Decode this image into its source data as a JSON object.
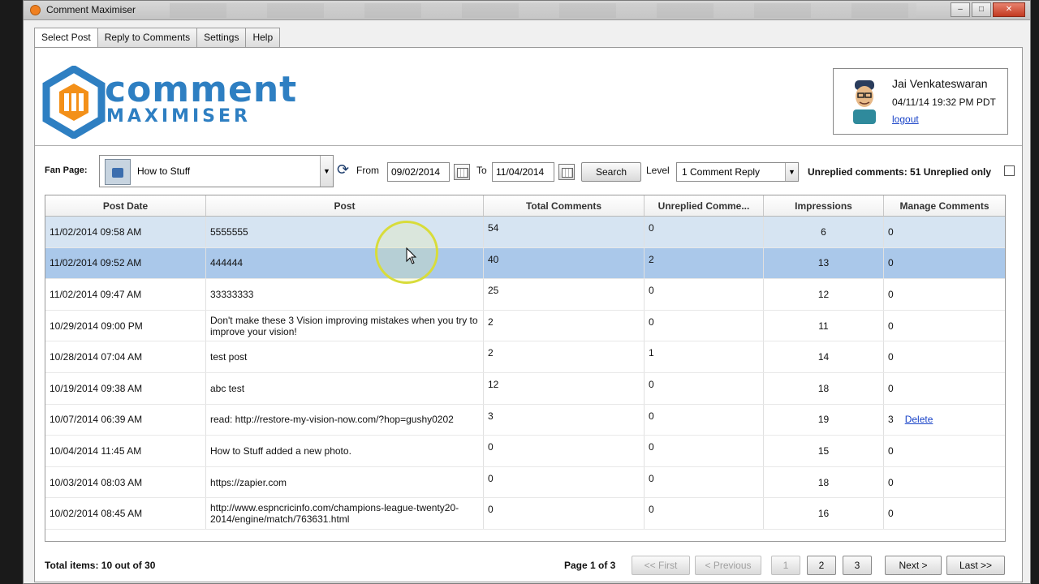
{
  "window": {
    "title": "Comment Maximiser"
  },
  "tabs": [
    "Select Post",
    "Reply to Comments",
    "Settings",
    "Help"
  ],
  "logo": {
    "line1": "comment",
    "line2": "MAXIMISER"
  },
  "user": {
    "name": "Jai Venkateswaran",
    "datetime": "04/11/14 19:32 PM  PDT",
    "logout": "logout"
  },
  "filters": {
    "fan_page_label": "Fan Page:",
    "fan_page_value": "How to Stuff",
    "from_label": "From",
    "from_value": "09/02/2014",
    "to_label": "To",
    "to_value": "11/04/2014",
    "search_label": "Search",
    "level_label": "Level",
    "level_value": "1 Comment Reply",
    "unreplied_text": "Unreplied comments: 51 Unreplied only"
  },
  "table": {
    "columns": [
      "Post Date",
      "Post",
      "Total Comments",
      "Unreplied Comme...",
      "Impressions",
      "Manage Comments"
    ],
    "rows": [
      {
        "date": "11/02/2014 09:58 AM",
        "post": "5555555",
        "total": "54",
        "unreplied": "0",
        "impressions": "6",
        "manage": "0"
      },
      {
        "date": "11/02/2014 09:52 AM",
        "post": "444444",
        "total": "40",
        "unreplied": "2",
        "impressions": "13",
        "manage": "0"
      },
      {
        "date": "11/02/2014 09:47 AM",
        "post": "33333333",
        "total": "25",
        "unreplied": "0",
        "impressions": "12",
        "manage": "0"
      },
      {
        "date": "10/29/2014 09:00 PM",
        "post": "Don't make these 3 Vision improving mistakes when you try to improve your vision!",
        "total": "2",
        "unreplied": "0",
        "impressions": "11",
        "manage": "0"
      },
      {
        "date": "10/28/2014 07:04 AM",
        "post": "test post",
        "total": "2",
        "unreplied": "1",
        "impressions": "14",
        "manage": "0"
      },
      {
        "date": "10/19/2014 09:38 AM",
        "post": "abc test",
        "total": "12",
        "unreplied": "0",
        "impressions": "18",
        "manage": "0"
      },
      {
        "date": "10/07/2014 06:39 AM",
        "post": "read: http://restore-my-vision-now.com/?hop=gushy0202",
        "total": "3",
        "unreplied": "0",
        "impressions": "19",
        "manage": "3",
        "delete": "Delete"
      },
      {
        "date": "10/04/2014 11:45 AM",
        "post": "How to Stuff added a new photo.",
        "total": "0",
        "unreplied": "0",
        "impressions": "15",
        "manage": "0"
      },
      {
        "date": "10/03/2014 08:03 AM",
        "post": "https://zapier.com",
        "total": "0",
        "unreplied": "0",
        "impressions": "18",
        "manage": "0"
      },
      {
        "date": "10/02/2014 08:45 AM",
        "post": "http://www.espncricinfo.com/champions-league-twenty20-2014/engine/match/763631.html",
        "total": "0",
        "unreplied": "0",
        "impressions": "16",
        "manage": "0"
      }
    ]
  },
  "footer": {
    "total_items": "Total items: 10 out of 30",
    "page_info": "Page 1 of 3",
    "first": "<< First",
    "previous": "< Previous",
    "pages": [
      "1",
      "2",
      "3"
    ],
    "next": "Next >",
    "last": "Last >>"
  }
}
